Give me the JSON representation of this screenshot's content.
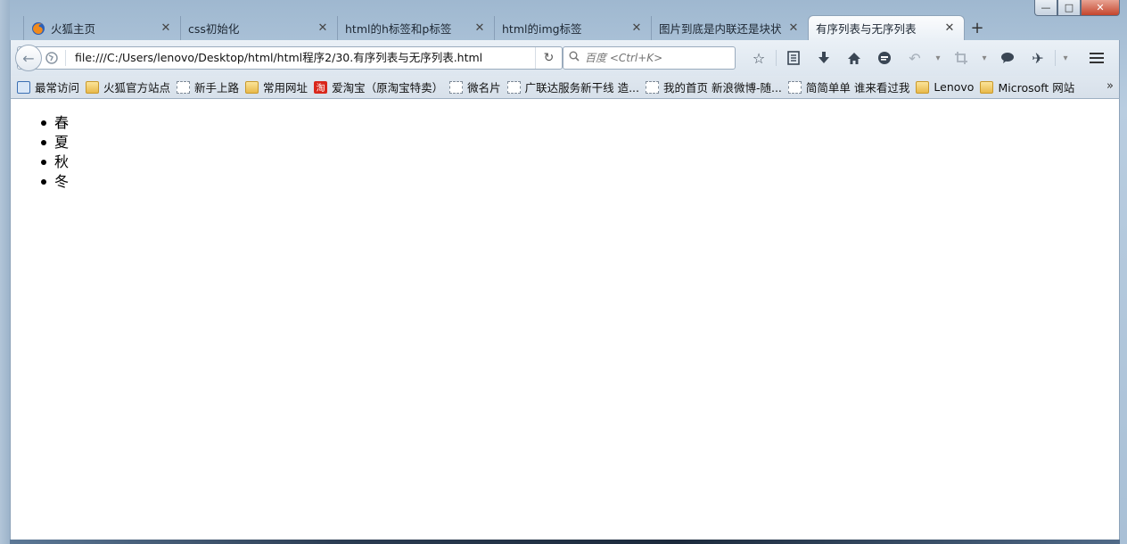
{
  "window": {
    "controls": {
      "minimize": "—",
      "maximize": "□",
      "close": "✕"
    }
  },
  "tabs": [
    {
      "label": "火狐主页",
      "icon": "firefox-icon",
      "active": false
    },
    {
      "label": "css初始化",
      "icon": "",
      "active": false
    },
    {
      "label": "html的h标签和p标签",
      "icon": "",
      "active": false
    },
    {
      "label": "html的img标签",
      "icon": "",
      "active": false
    },
    {
      "label": "图片到底是内联还是块状",
      "icon": "",
      "active": false
    },
    {
      "label": "有序列表与无序列表",
      "icon": "",
      "active": true
    }
  ],
  "tab_close_glyph": "✕",
  "new_tab_glyph": "+",
  "navbar": {
    "back_glyph": "←",
    "url": "file:///C:/Users/lenovo/Desktop/html/html程序2/30.有序列表与无序列表.html",
    "reload_glyph": "↻",
    "search_placeholder": "百度 <Ctrl+K>",
    "icons": [
      "bookmark-star-icon",
      "reading-list-icon",
      "download-icon",
      "home-icon",
      "chat-icon",
      "undo-icon",
      "crop-icon",
      "comment-icon",
      "addon-icon",
      "menu-icon"
    ]
  },
  "bookmarks": [
    {
      "label": "最常访问",
      "icon": "smart-folder-icon"
    },
    {
      "label": "火狐官方站点",
      "icon": "folder-icon"
    },
    {
      "label": "新手上路",
      "icon": "page-icon"
    },
    {
      "label": "常用网址",
      "icon": "folder-icon"
    },
    {
      "label": "爱淘宝（原淘宝特卖）",
      "icon": "taobao-icon"
    },
    {
      "label": "微名片",
      "icon": "page-icon"
    },
    {
      "label": "广联达服务新干线 造...",
      "icon": "page-icon"
    },
    {
      "label": "我的首页 新浪微博-随...",
      "icon": "page-icon"
    },
    {
      "label": "简简单单 谁来看过我",
      "icon": "page-icon"
    },
    {
      "label": "Lenovo",
      "icon": "folder-icon"
    },
    {
      "label": "Microsoft 网站",
      "icon": "folder-icon"
    }
  ],
  "bookmarks_more": "»",
  "page": {
    "list_items": [
      "春",
      "夏",
      "秋",
      "冬"
    ]
  },
  "colors": {
    "tab_active_bg": "#f5f8fb",
    "chrome_bg": "#dde6ef",
    "content_bg": "#ffffff"
  }
}
